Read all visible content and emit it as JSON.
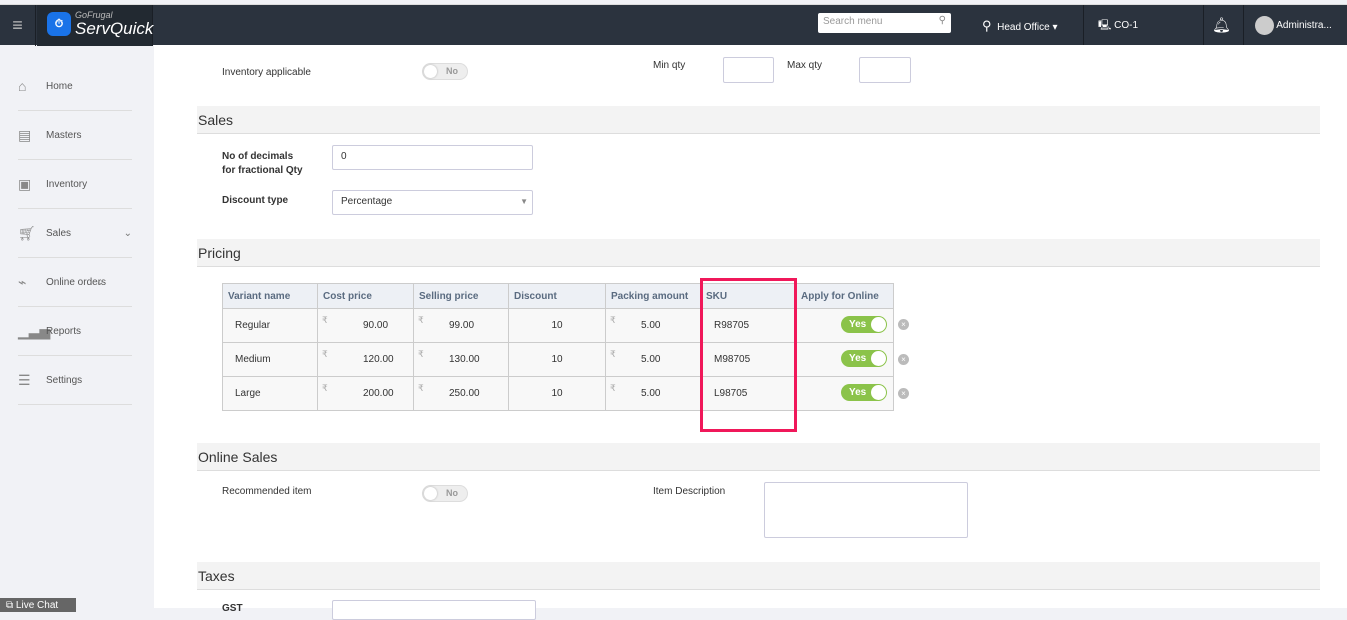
{
  "header": {
    "brand_top": "GoFrugal",
    "brand": "ServQuick",
    "search_placeholder": "Search menu",
    "location": "Head Office",
    "counter": "CO-1",
    "user": "Administra..."
  },
  "sidebar": {
    "items": [
      {
        "label": "Home"
      },
      {
        "label": "Masters"
      },
      {
        "label": "Inventory"
      },
      {
        "label": "Sales"
      },
      {
        "label": "Online orders"
      },
      {
        "label": "Reports"
      },
      {
        "label": "Settings"
      }
    ]
  },
  "inventory": {
    "label": "Inventory applicable",
    "toggle": "No",
    "min_qty": "Min qty",
    "max_qty": "Max qty"
  },
  "sales": {
    "title": "Sales",
    "decimals_label_1": "No of decimals",
    "decimals_label_2": "for fractional Qty",
    "decimals_value": "0",
    "discount_type_label": "Discount type",
    "discount_type": "Percentage"
  },
  "pricing": {
    "title": "Pricing",
    "currency": "₹",
    "columns": [
      "Variant name",
      "Cost price",
      "Selling price",
      "Discount",
      "Packing amount",
      "SKU",
      "Apply for Online"
    ],
    "rows": [
      {
        "variant": "Regular",
        "cost": "90.00",
        "selling": "99.00",
        "discount": "10",
        "packing": "5.00",
        "sku": "R98705",
        "online": "Yes"
      },
      {
        "variant": "Medium",
        "cost": "120.00",
        "selling": "130.00",
        "discount": "10",
        "packing": "5.00",
        "sku": "M98705",
        "online": "Yes"
      },
      {
        "variant": "Large",
        "cost": "200.00",
        "selling": "250.00",
        "discount": "10",
        "packing": "5.00",
        "sku": "L98705",
        "online": "Yes"
      }
    ]
  },
  "online_sales": {
    "title": "Online Sales",
    "recommended": "Recommended item",
    "toggle": "No",
    "description": "Item Description"
  },
  "taxes": {
    "title": "Taxes",
    "gst": "GST"
  },
  "live_chat": "Live Chat"
}
